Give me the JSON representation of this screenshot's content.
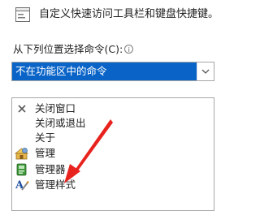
{
  "header": {
    "text": "自定义快速访问工具栏和键盘快捷键。"
  },
  "command_chooser": {
    "label": "从下列位置选择命令(C):",
    "info_icon": "info-icon",
    "selected": "不在功能区中的命令"
  },
  "command_list": {
    "items": [
      {
        "label": "关闭窗口",
        "icon": "close-x-icon"
      },
      {
        "label": "关闭或退出",
        "icon": ""
      },
      {
        "label": "关于",
        "icon": ""
      },
      {
        "label": "管理",
        "icon": "manage-icon"
      },
      {
        "label": "管理器",
        "icon": "manager-icon"
      },
      {
        "label": "管理样式",
        "icon": "manage-styles-icon"
      }
    ]
  },
  "colors": {
    "selection": "#0a64c8",
    "annotation_arrow": "#e8231e"
  }
}
